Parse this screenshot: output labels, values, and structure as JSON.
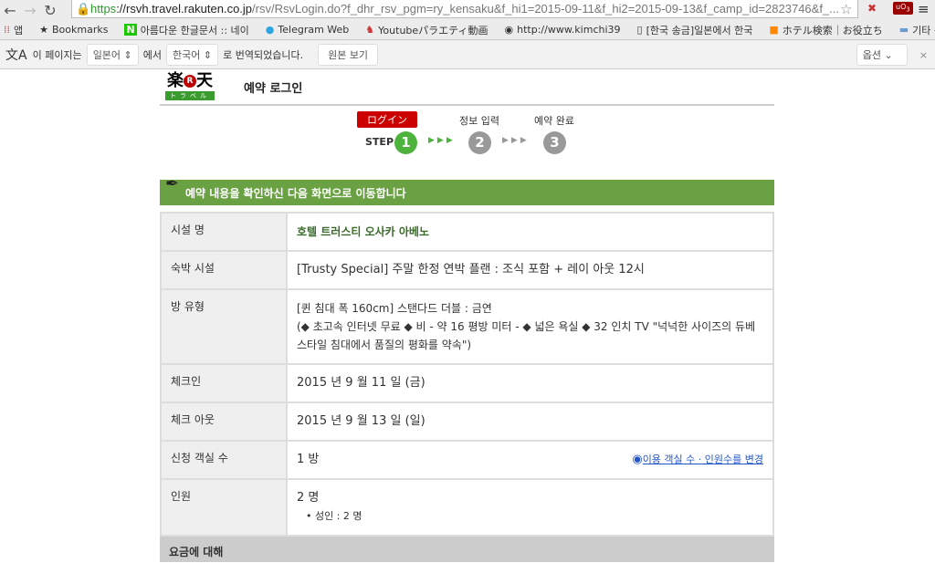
{
  "browser": {
    "url_scheme": "https",
    "url_host": "://rsvh.travel.rakuten.co.jp",
    "url_path": "/rsv/RsvLogin.do?f_dhr_rsv_pgm=ry_kensaku&f_hi1=2015-09-11&f_hi2=2015-09-13&f_camp_id=2823746&f_...",
    "ublock_count": "3",
    "bookmarks": [
      "앱",
      "Bookmarks",
      "아름다운 한글문서 :: 네이",
      "Telegram Web",
      "Youtubeパラエティ動画",
      "http://www.kimchi39",
      "[한국 송금]일본에서 한국",
      "ホテル検索｜お役立ち"
    ],
    "other_bookmarks": "기타 북마크"
  },
  "translate": {
    "prefix": "이 페이지는",
    "from": "일본어",
    "mid": "에서",
    "to": "한국어",
    "suffix": "로 번역되었습니다.",
    "show_original": "원본 보기",
    "options": "옵션"
  },
  "page": {
    "logo_text": "楽天",
    "logo_sub": "トラベル",
    "title": "예약 로그인",
    "steps": {
      "bubble": "ログイン",
      "step_label": "STEP",
      "s1": "1",
      "s2": "2",
      "s3": "3",
      "label2": "정보 입력",
      "label3": "예약 완료"
    },
    "banner": "예약 내용을 확인하신 다음 화면으로 이동합니다",
    "rows": [
      {
        "label": "시설 명",
        "value": "호텔 트러스티 오사카 아베노"
      },
      {
        "label": "숙박 시설",
        "value": "[Trusty Special] 주말 한정 연박 플랜 : 조식 포함 + 레이 아웃 12시"
      },
      {
        "label": "방 유형",
        "value": "[퀸 침대 폭 160cm] 스탠다드 더블 : 금연",
        "value2": "(◆ 초고속 인터넷 무료 ◆ 비 - 약 16 평방 미터 - ◆ 넓은 욕실 ◆ 32 인치 TV \"넉넉한 사이즈의 듀베 스타일 침대에서 품질의 평화를 약속\")"
      },
      {
        "label": "체크인",
        "value": "2015 년 9 월 11 일 (금)"
      },
      {
        "label": "체크 아웃",
        "value": "2015 년 9 월 13 일 (일)"
      },
      {
        "label": "신청 객실 수",
        "value": "1 방",
        "link": "이용 객실 수 · 인원수를 변경"
      },
      {
        "label": "인원",
        "value": "2 명",
        "value2": "• 성인 : 2 명"
      }
    ],
    "fee_header": "요금에 대해"
  }
}
